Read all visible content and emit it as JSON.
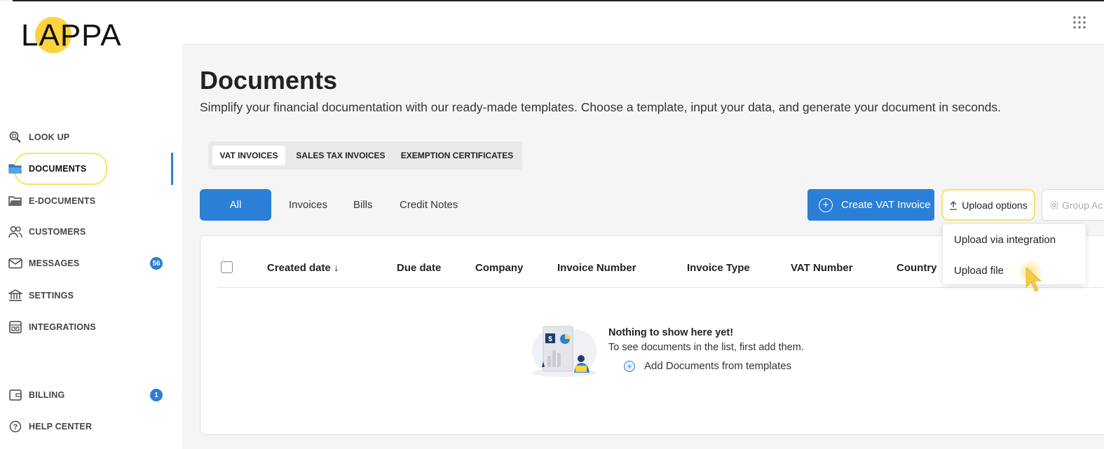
{
  "app": {
    "logo": "LAPPA"
  },
  "sidebar": {
    "items": [
      {
        "label": "LOOK UP",
        "icon": "search-doc-icon"
      },
      {
        "label": "DOCUMENTS",
        "icon": "folder-filled-icon",
        "active": true
      },
      {
        "label": "E-DOCUMENTS",
        "icon": "folder-open-icon"
      },
      {
        "label": "CUSTOMERS",
        "icon": "users-icon"
      },
      {
        "label": "MESSAGES",
        "icon": "mail-icon",
        "badge": "56"
      },
      {
        "label": "SETTINGS",
        "icon": "bank-icon"
      },
      {
        "label": "INTEGRATIONS",
        "icon": "integrations-icon"
      },
      {
        "label": "BILLING",
        "icon": "wallet-icon",
        "badge": "1"
      },
      {
        "label": "HELP CENTER",
        "icon": "help-icon"
      }
    ]
  },
  "header": {
    "apps_icon": "grid-dots-icon"
  },
  "page": {
    "title": "Documents",
    "subtitle": "Simplify your financial documentation with our ready-made templates. Choose a template, input your data, and generate your document in seconds."
  },
  "category_tabs": [
    "VAT INVOICES",
    "SALES TAX INVOICES",
    "EXEMPTION CERTIFICATES"
  ],
  "filter_tabs": [
    "All",
    "Invoices",
    "Bills",
    "Credit Notes"
  ],
  "actions": {
    "create": "Create VAT Invoice",
    "upload": "Upload options",
    "group": "Group Ac"
  },
  "upload_menu": [
    "Upload via integration",
    "Upload file"
  ],
  "table": {
    "columns": [
      "Created date ↓",
      "Due date",
      "Company",
      "Invoice Number",
      "Invoice Type",
      "VAT Number",
      "Country"
    ]
  },
  "empty_state": {
    "title": "Nothing to show here yet!",
    "description": "To see documents in the list, first add them.",
    "link": "Add Documents from templates"
  },
  "colors": {
    "accent": "#2b7fd6",
    "highlight": "#f4e36b",
    "logo_sun": "#fbd33f"
  }
}
